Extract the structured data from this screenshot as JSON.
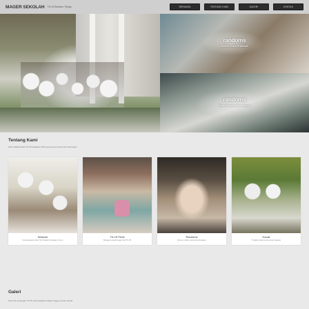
{
  "header": {
    "brand": "MAGER SEKOLAH",
    "brand_sub": "TKJ B Random Things",
    "nav": [
      "BERANDA",
      "TENTANG KAMI",
      "GALERI",
      "KONTAK"
    ]
  },
  "hero": {
    "right_top": {
      "title": "randoms",
      "subtitle": "Momen Gabut di sekolah"
    },
    "right_bottom": {
      "title": "randoms",
      "subtitle": "Tidur di tengah jam pelajaran"
    }
  },
  "about": {
    "title": "Tentang Kami",
    "desc": "Kami adalah kelas TKJ B angkatan 2019 yang penuh warna dan kenangan"
  },
  "cards": [
    {
      "label": "Network",
      "desc": "Kebersamaan kelas TKJ B dalam berbagai momen"
    },
    {
      "label": "TKJ B Pride",
      "desc": "Bangga menjadi bagian dari TKJ B"
    },
    {
      "label": "Randoms",
      "desc": "Momen random yang tak terlupakan"
    },
    {
      "label": "Kocak",
      "desc": "Tingkah kocak teman-teman sekelas"
    }
  ],
  "gallery": {
    "title": "Galeri",
    "desc": "Foto-foto kenangan TKJ B, dari kegiatan belajar hingga momen santai"
  }
}
